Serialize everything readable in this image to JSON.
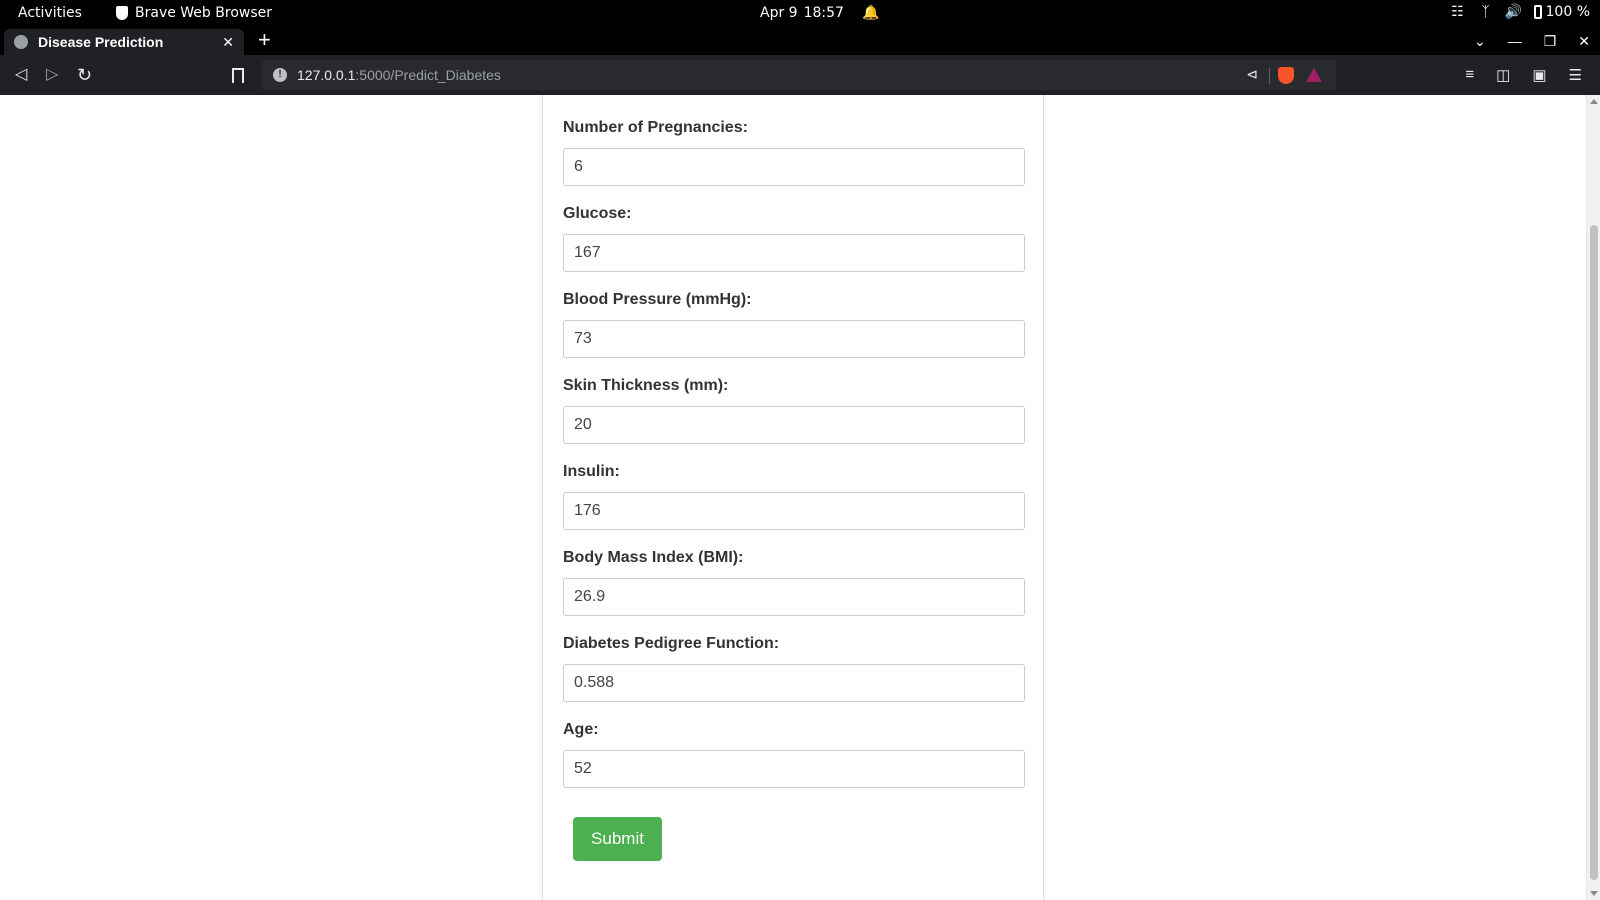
{
  "os_bar": {
    "activities": "Activities",
    "app_name": "Brave Web Browser",
    "date": "Apr 9",
    "time": "18:57",
    "battery": "100 %"
  },
  "browser": {
    "tab_title": "Disease Prediction",
    "url_host": "127.0.0.1",
    "url_rest": ":5000/Predict_Diabetes"
  },
  "form": {
    "fields": [
      {
        "label": "Number of Pregnancies:",
        "value": "6"
      },
      {
        "label": "Glucose:",
        "value": "167"
      },
      {
        "label": "Blood Pressure (mmHg):",
        "value": "73"
      },
      {
        "label": "Skin Thickness (mm):",
        "value": "20"
      },
      {
        "label": "Insulin:",
        "value": "176"
      },
      {
        "label": "Body Mass Index (BMI):",
        "value": "26.9"
      },
      {
        "label": "Diabetes Pedigree Function:",
        "value": "0.588"
      },
      {
        "label": "Age:",
        "value": "52"
      }
    ],
    "submit_label": "Submit"
  },
  "colors": {
    "submit_button": "#4caf50",
    "chrome_dark": "#202124",
    "brave_orange": "#fb542b"
  }
}
